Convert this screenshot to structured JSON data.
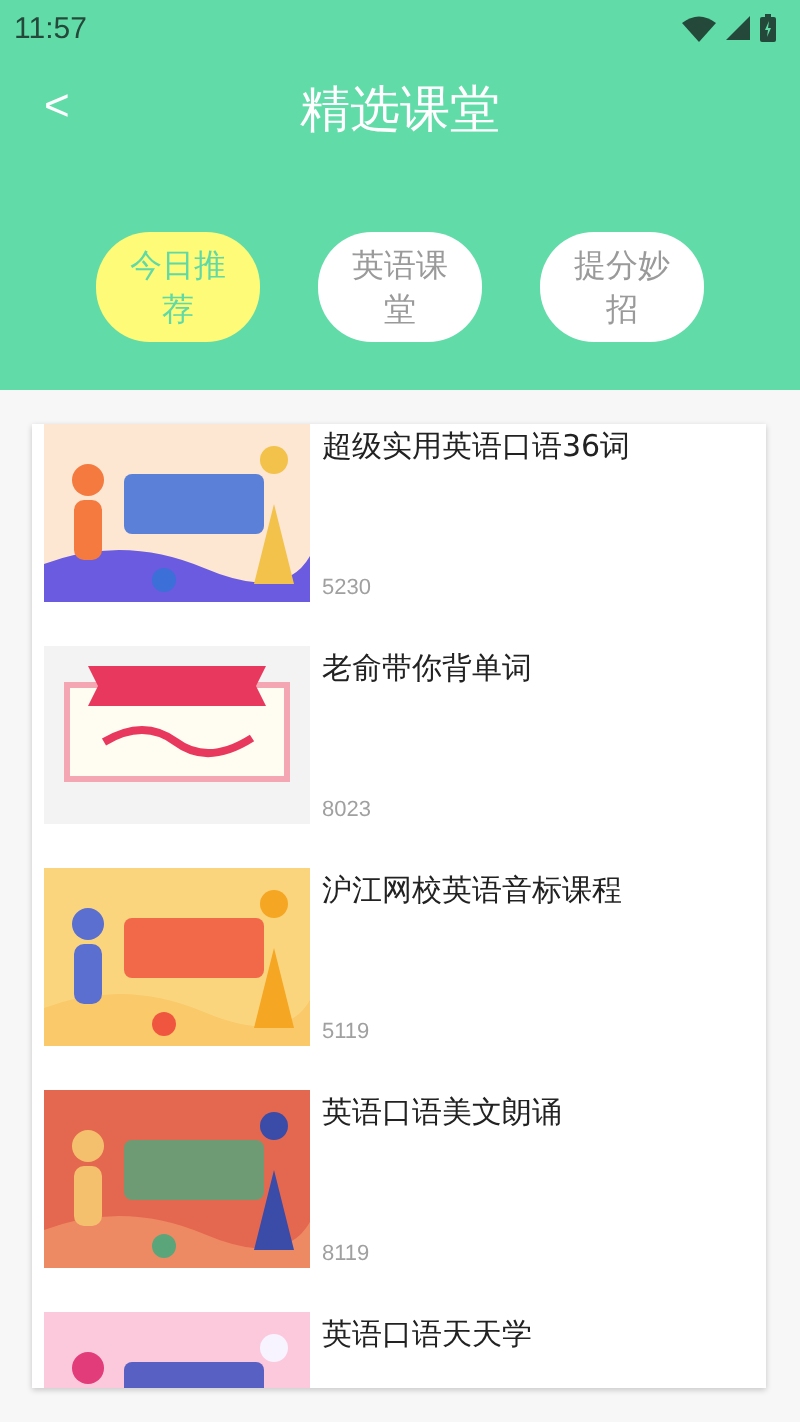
{
  "status_bar": {
    "time": "11:57"
  },
  "header": {
    "back": "<",
    "title": "精选课堂"
  },
  "tabs": [
    {
      "label": "今日推荐",
      "selected": true
    },
    {
      "label": "英语课堂",
      "selected": false
    },
    {
      "label": "提分妙招",
      "selected": false
    }
  ],
  "courses": [
    {
      "title": "超级实用英语口语36词",
      "count": "5230"
    },
    {
      "title": "老俞带你背单词",
      "count": "8023"
    },
    {
      "title": "沪江网校英语音标课程",
      "count": "5119"
    },
    {
      "title": "英语口语美文朗诵",
      "count": "8119"
    },
    {
      "title": "英语口语天天学"
    }
  ]
}
